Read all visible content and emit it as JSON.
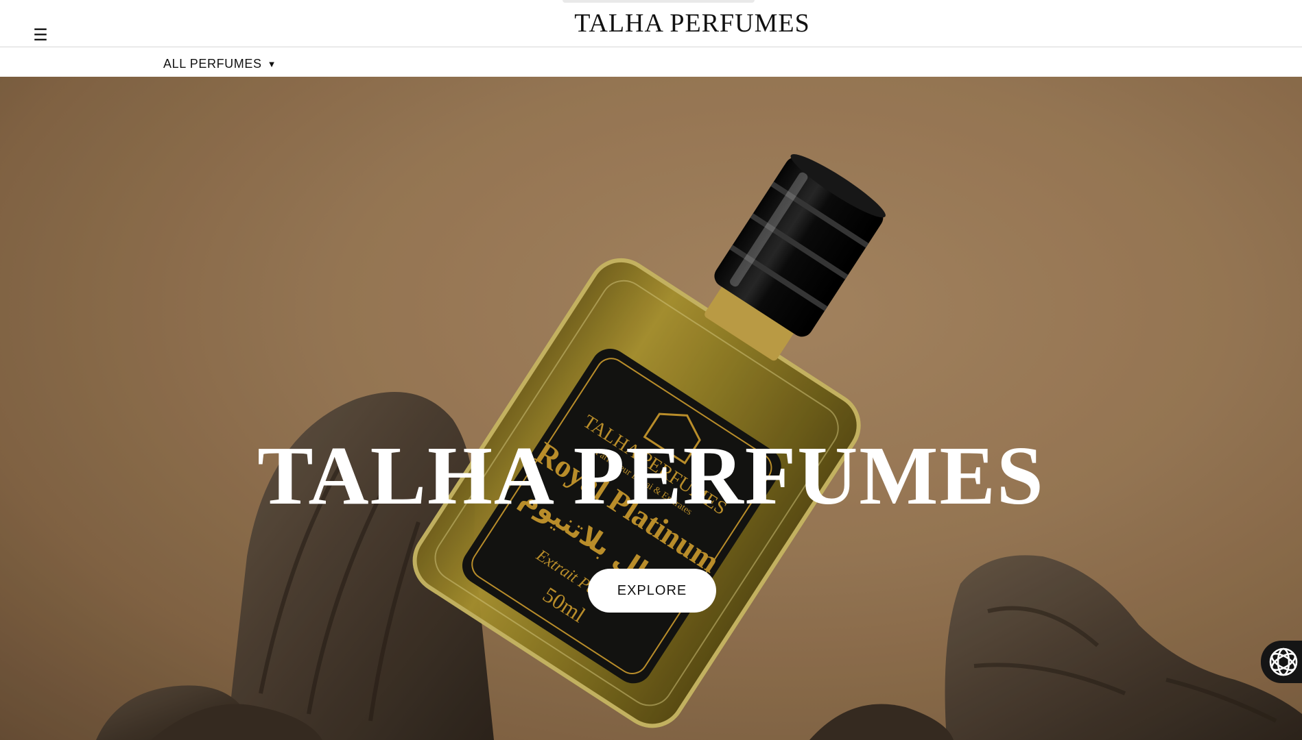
{
  "header": {
    "brand": "TALHA PERFUMES",
    "menu_icon": "☰"
  },
  "nav": {
    "items": [
      {
        "label": "ALL PERFUMES",
        "caret": "▼"
      }
    ]
  },
  "hero": {
    "title": "TALHA PERFUMES",
    "cta_label": "EXPLORE",
    "bottle_label": {
      "brand": "TALHA PERFUMES",
      "tagline": "Parfumeur Dubai & Emirates",
      "name": "Royal Platinum",
      "arabic_name": "رويال بلاتنيوم",
      "type": "Extrait Parfum",
      "volume": "50ml"
    }
  },
  "chat_widget": {
    "icon": "chat-assistant-icon"
  },
  "colors": {
    "hero_background": "#a17f5a",
    "label_gold": "#c99a2e",
    "cap_black": "#111111"
  }
}
